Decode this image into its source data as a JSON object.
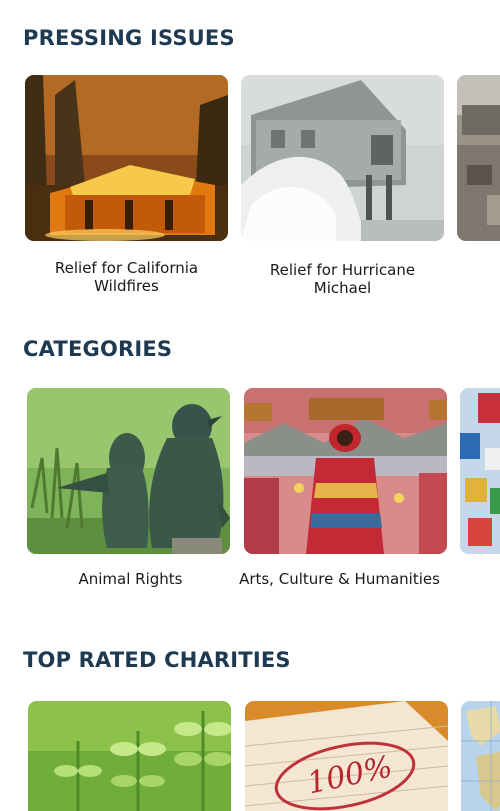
{
  "sections": [
    {
      "title": "PRESSING ISSUES",
      "cards": [
        {
          "label": "Relief for California Wildfires",
          "image": "burning-house-wildfire"
        },
        {
          "label": "Relief for Hurricane Michael",
          "image": "hurricane-waves-house"
        },
        {
          "label": "",
          "image": "storm-debris"
        }
      ]
    },
    {
      "title": "CATEGORIES",
      "cards": [
        {
          "label": "Animal Rights",
          "image": "penguins"
        },
        {
          "label": "Arts, Culture & Humanities",
          "image": "folk-art-painting"
        },
        {
          "label": "",
          "image": "flags"
        }
      ]
    },
    {
      "title": "TOP RATED CHARITIES",
      "cards": [
        {
          "label": "",
          "image": "green-seedlings"
        },
        {
          "label": "",
          "image": "100-percent-note"
        },
        {
          "label": "",
          "image": "world-map"
        }
      ]
    }
  ]
}
